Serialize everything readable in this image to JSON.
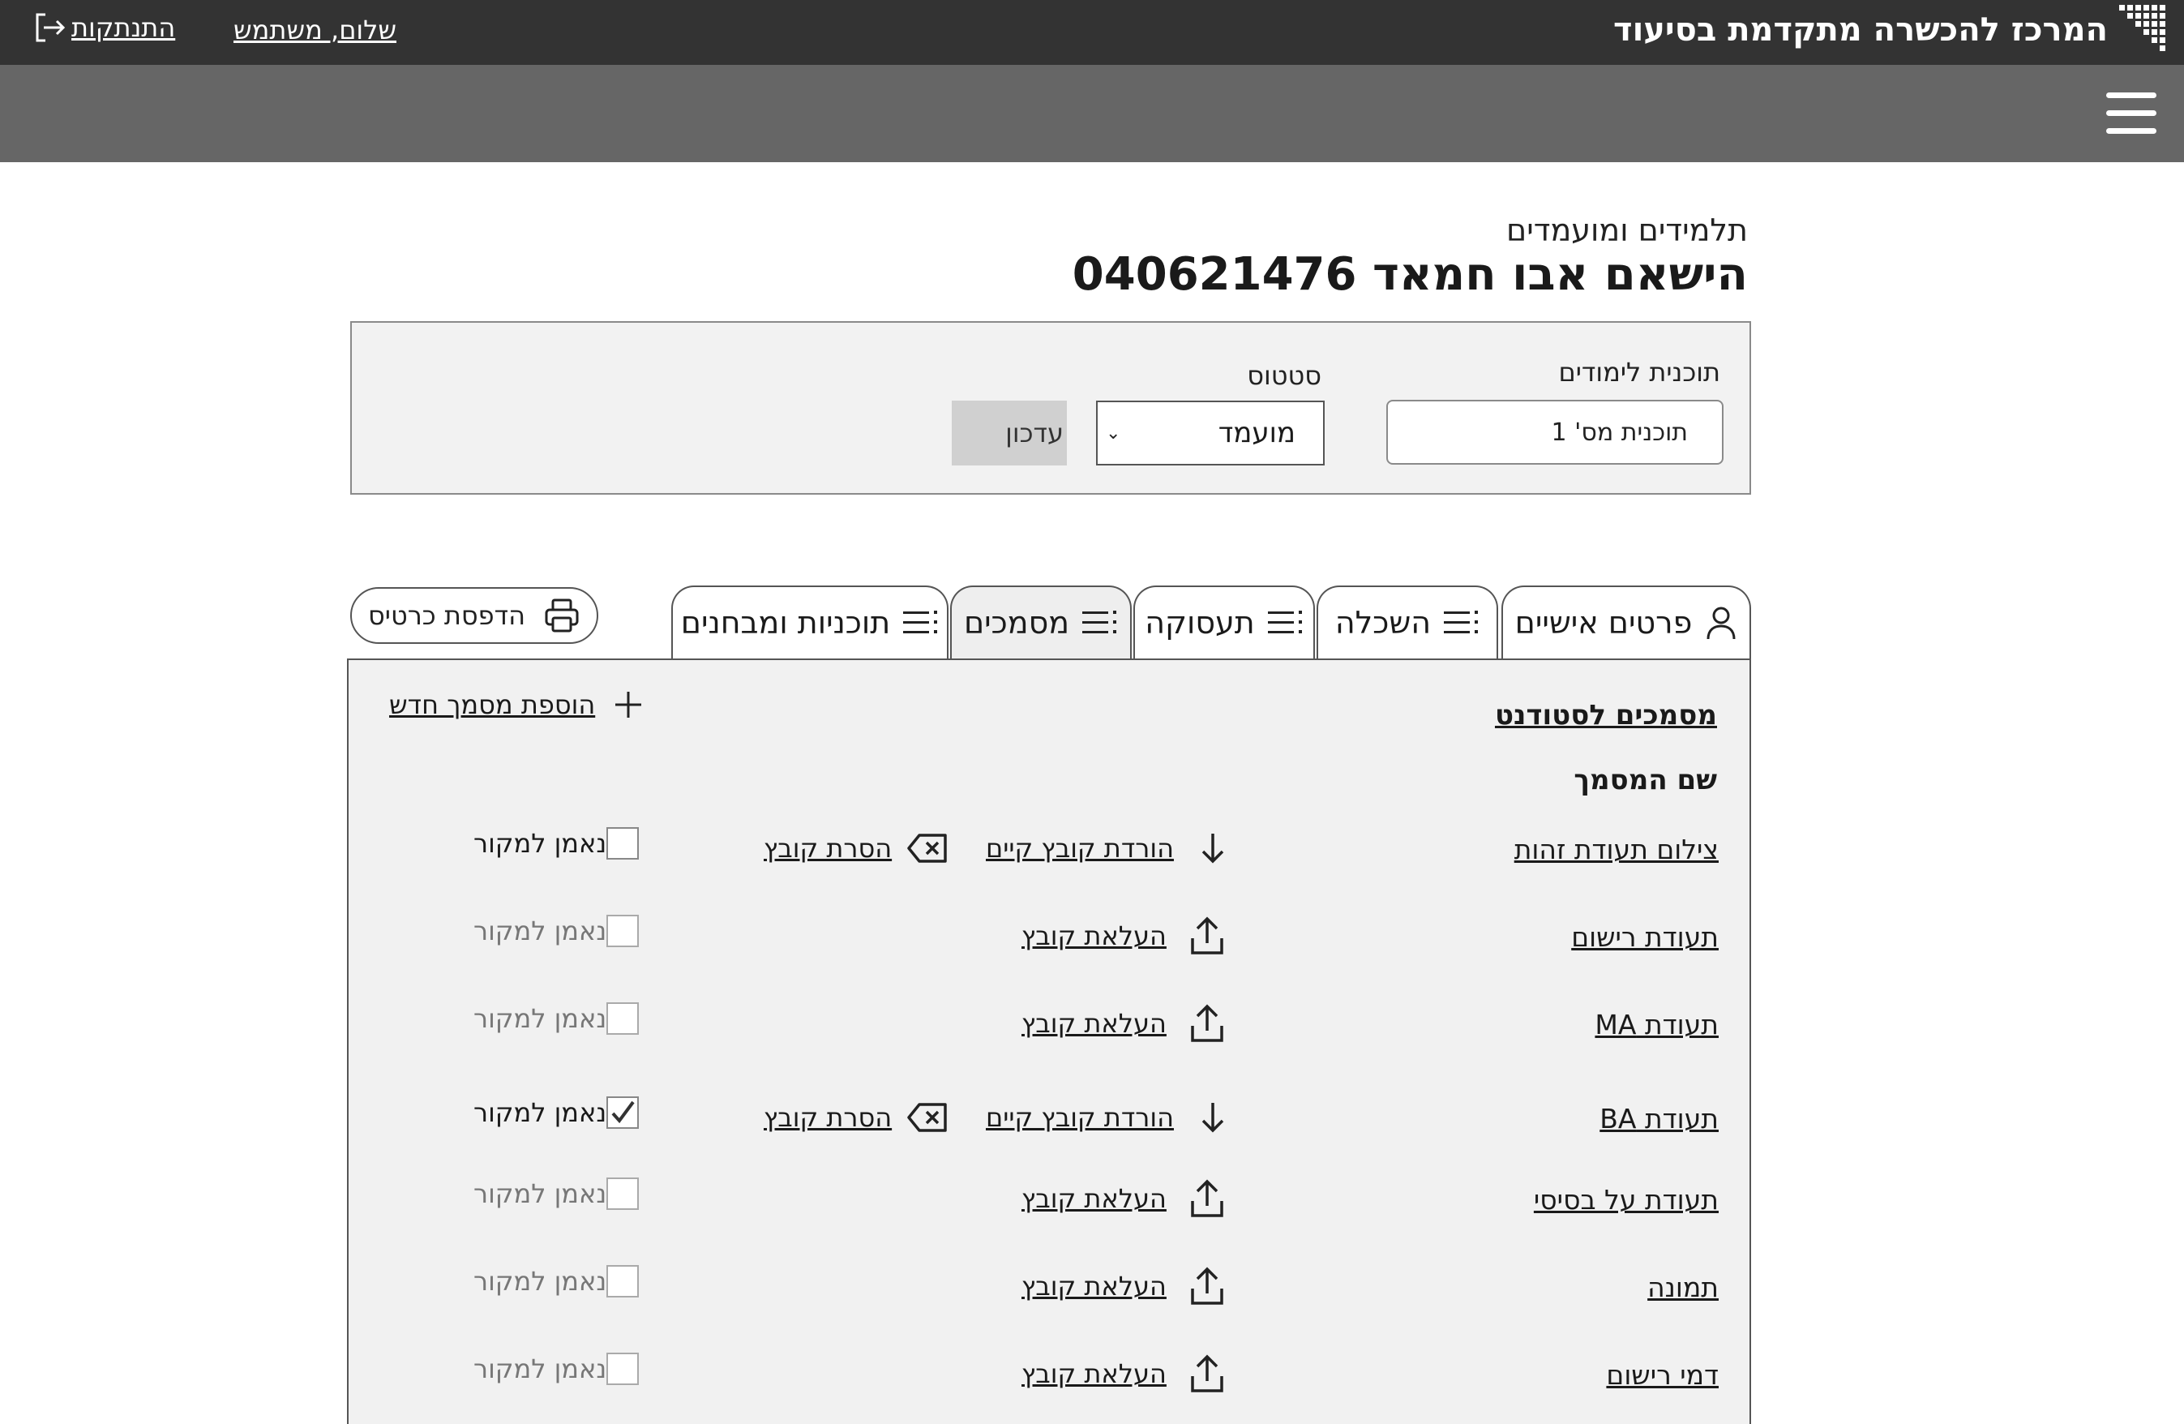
{
  "topbar": {
    "brand": "המרכז להכשרה מתקדמת בסיעוד",
    "greeting": "שלום, משתמש",
    "logout": "התנתקות"
  },
  "page": {
    "section_label": "תלמידים ומועמדים",
    "student_title": "הישאם אבו חמאד 040621476"
  },
  "program_panel": {
    "program_label": "תוכנית לימודים",
    "program_value": "תוכנית מס' 1",
    "status_label": "סטטוס",
    "status_value": "מועמד",
    "update_label": "עדכון"
  },
  "tabs": [
    {
      "label": "פרטים אישיים",
      "icon": "person-icon",
      "active": false
    },
    {
      "label": "השכלה",
      "icon": "list-icon",
      "active": false
    },
    {
      "label": "תעסוקה",
      "icon": "list-icon",
      "active": false
    },
    {
      "label": "מסמכים",
      "icon": "list-icon",
      "active": true
    },
    {
      "label": "תוכניות ומבחנים",
      "icon": "list-icon",
      "active": false
    }
  ],
  "print_button": {
    "label": "הדפסת כרטיס",
    "icon": "printer-icon"
  },
  "documents": {
    "heading": "מסמכים לסטודנט",
    "column_header": "שם המסמך",
    "add_label": "הוספת מסמך חדש",
    "download_label": "הורדת קובץ קיים",
    "upload_label": "העלאת קובץ",
    "remove_label": "הסרת קובץ",
    "original_label": "נאמן למקור",
    "rows": [
      {
        "name": "צילום תעודת זהות",
        "has_file": true,
        "original_checked": false
      },
      {
        "name": "תעודת רישום",
        "has_file": false,
        "original_checked": false
      },
      {
        "name": "תעודת MA",
        "has_file": false,
        "original_checked": false
      },
      {
        "name": "תעודת BA",
        "has_file": true,
        "original_checked": true
      },
      {
        "name": "תעודת על בסיסי",
        "has_file": false,
        "original_checked": false
      },
      {
        "name": "תמונה",
        "has_file": false,
        "original_checked": false
      },
      {
        "name": "דמי רישום",
        "has_file": false,
        "original_checked": false
      }
    ]
  },
  "colors": {
    "topbar": "#333333",
    "subbar": "#666666",
    "panel_bg": "#f1f1f1"
  }
}
